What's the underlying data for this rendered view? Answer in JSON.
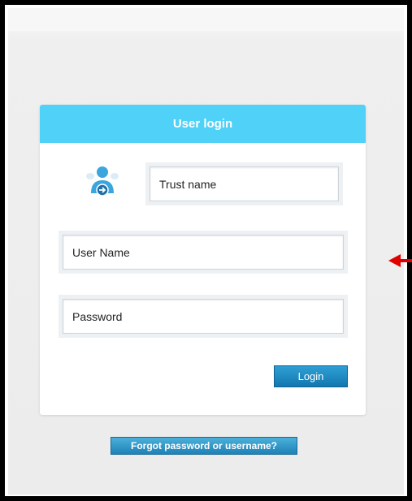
{
  "login_card": {
    "title": "User login",
    "trust_name_placeholder": "Trust name",
    "username_placeholder": "User Name",
    "password_placeholder": "Password",
    "login_label": "Login"
  },
  "forgot": {
    "label": "Forgot password or username?"
  },
  "icons": {
    "avatar": "user-login-icon",
    "annotation": "red-arrow-icon"
  },
  "colors": {
    "header": "#4fd1f8",
    "button": "#1a86c2",
    "annotation": "#e00000",
    "frame": "#000000"
  }
}
